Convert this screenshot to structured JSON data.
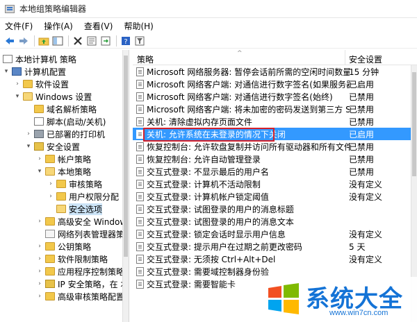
{
  "window": {
    "title": "本地组策略编辑器"
  },
  "menu": [
    "文件(F)",
    "操作(A)",
    "查看(V)",
    "帮助(H)"
  ],
  "toolbar": [
    "back-icon",
    "forward-icon",
    "up-folder-icon",
    "show-hide-tree-icon",
    "delete-icon",
    "properties-icon",
    "export-list-icon",
    "help-icon",
    "filter-icon"
  ],
  "tree": [
    {
      "label": "本地计算机 策略",
      "icon": "doc",
      "twisty": ""
    },
    {
      "label": "计算机配置",
      "icon": "pc",
      "twisty": "▾"
    },
    {
      "label": "软件设置",
      "icon": "folder",
      "twisty": "›"
    },
    {
      "label": "Windows 设置",
      "icon": "folder",
      "twisty": "▾"
    },
    {
      "label": "域名解析策略",
      "icon": "folder",
      "twisty": ""
    },
    {
      "label": "脚本(启动/关机)",
      "icon": "doc",
      "twisty": ""
    },
    {
      "label": "已部署的打印机",
      "icon": "printer",
      "twisty": "›"
    },
    {
      "label": "安全设置",
      "icon": "shield",
      "twisty": "▾"
    },
    {
      "label": "帐户策略",
      "icon": "folder",
      "twisty": "›"
    },
    {
      "label": "本地策略",
      "icon": "folder",
      "twisty": "▾"
    },
    {
      "label": "审核策略",
      "icon": "folder",
      "twisty": "›"
    },
    {
      "label": "用户权限分配",
      "icon": "folder",
      "twisty": "›"
    },
    {
      "label": "安全选项",
      "icon": "folder open",
      "twisty": "",
      "selected": true
    },
    {
      "label": "高级安全 Windows",
      "icon": "folder",
      "twisty": "›"
    },
    {
      "label": "网络列表管理器策略",
      "icon": "net",
      "twisty": ""
    },
    {
      "label": "公钥策略",
      "icon": "folder",
      "twisty": "›"
    },
    {
      "label": "软件限制策略",
      "icon": "folder",
      "twisty": "›"
    },
    {
      "label": "应用程序控制策略",
      "icon": "folder",
      "twisty": "›"
    },
    {
      "label": "IP 安全策略，在 本",
      "icon": "shield",
      "twisty": "›"
    },
    {
      "label": "高级审核策略配置",
      "icon": "folder",
      "twisty": "›"
    }
  ],
  "list": {
    "columns": {
      "policy": "策略",
      "setting": "安全设置"
    },
    "rows": [
      {
        "name": "Microsoft 网络服务器: 暂停会话前所需的空闲时间数量",
        "value": "15 分钟"
      },
      {
        "name": "Microsoft 网络客户端: 对通信进行数字签名(如果服务器允...",
        "value": "已启用"
      },
      {
        "name": "Microsoft 网络客户端: 对通信进行数字签名(始终)",
        "value": "已禁用"
      },
      {
        "name": "Microsoft 网络客户端: 将未加密的密码发送到第三方 SMB...",
        "value": "已禁用"
      },
      {
        "name": "关机: 清除虚拟内存页面文件",
        "value": "已禁用"
      },
      {
        "name": "关机: 允许系统在未登录的情况下关闭",
        "value": "已启用",
        "highlight": true
      },
      {
        "name": "恢复控制台: 允许软盘复制并访问所有驱动器和所有文件夹",
        "value": "已禁用"
      },
      {
        "name": "恢复控制台: 允许自动管理登录",
        "value": "已禁用"
      },
      {
        "name": "交互式登录: 不显示最后的用户名",
        "value": "已禁用"
      },
      {
        "name": "交互式登录: 计算机不活动限制",
        "value": "没有定义"
      },
      {
        "name": "交互式登录: 计算机帐户锁定阈值",
        "value": "没有定义"
      },
      {
        "name": "交互式登录: 试图登录的用户的消息标题",
        "value": ""
      },
      {
        "name": "交互式登录: 试图登录的用户的消息文本",
        "value": ""
      },
      {
        "name": "交互式登录: 锁定会话时显示用户信息",
        "value": "没有定义"
      },
      {
        "name": "交互式登录: 提示用户在过期之前更改密码",
        "value": "5 天"
      },
      {
        "name": "交互式登录: 无须按 Ctrl+Alt+Del",
        "value": "没有定义"
      },
      {
        "name": "交互式登录: 需要域控制器身份验",
        "value": ""
      },
      {
        "name": "交互式登录: 需要智能卡",
        "value": ""
      }
    ]
  },
  "watermark": {
    "title": "系统大全",
    "url": "www.win7cn.com"
  }
}
